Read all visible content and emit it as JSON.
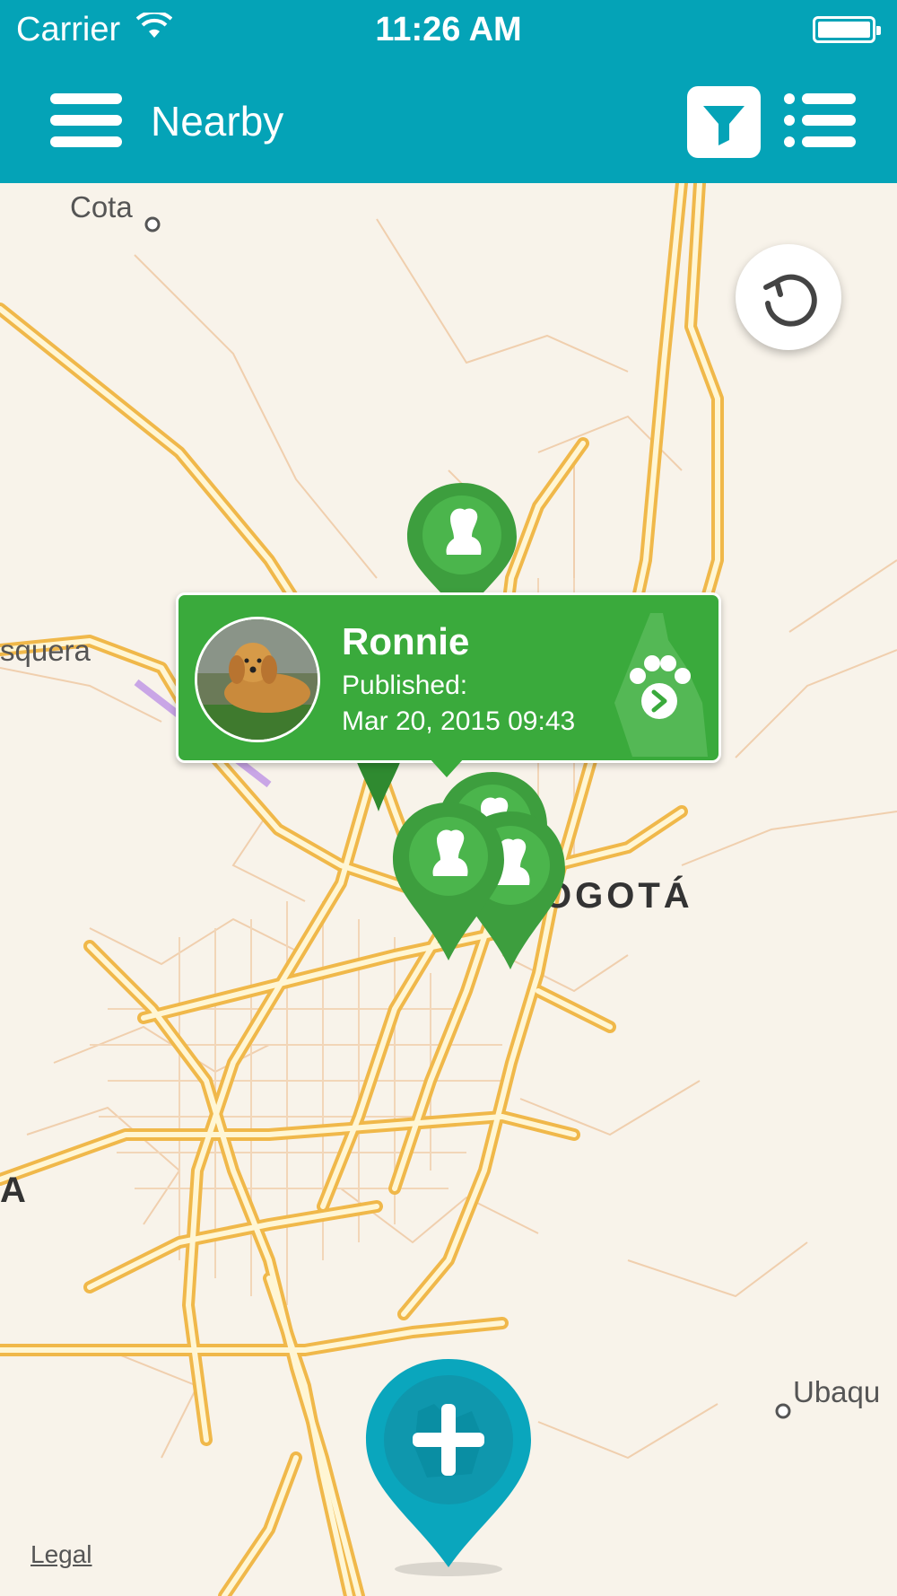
{
  "status_bar": {
    "carrier": "Carrier",
    "time": "11:26 AM"
  },
  "nav": {
    "title": "Nearby",
    "menu_icon": "hamburger-menu-icon",
    "filter_icon": "filter-icon",
    "list_icon": "list-view-icon"
  },
  "map": {
    "labels": {
      "cota": "Cota",
      "mosquera": "squera",
      "bogota": "OGOTÁ",
      "ubaque": "Ubaqu",
      "left_edge": "A"
    },
    "legal": "Legal",
    "refresh_icon": "refresh-icon",
    "add_icon": "add-pet-plus-icon"
  },
  "callout": {
    "name": "Ronnie",
    "published_label": "Published:",
    "date": "Mar 20, 2015 09:43",
    "action_icon": "paw-arrow-icon"
  },
  "colors": {
    "bar": "#04a3b7",
    "pin_green": "#3aaa3c",
    "add_pin": "#0aa6bd",
    "road": "#f5c55a",
    "map_bg": "#f8f3ea"
  }
}
